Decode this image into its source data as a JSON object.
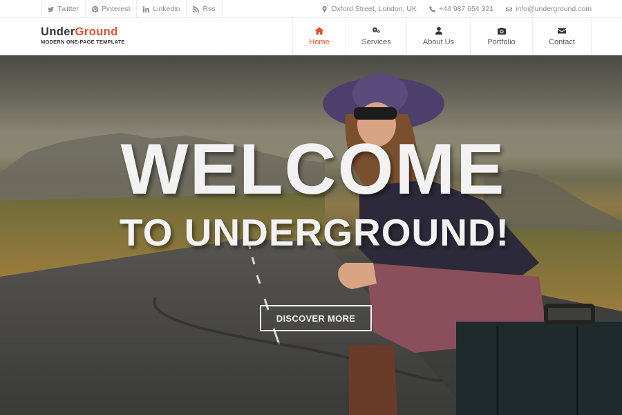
{
  "topbar": {
    "social": [
      {
        "label": "Twitter",
        "icon": "twitter-icon"
      },
      {
        "label": "Pinterest",
        "icon": "pinterest-icon"
      },
      {
        "label": "Linkedin",
        "icon": "linkedin-icon"
      },
      {
        "label": "Rss",
        "icon": "rss-icon"
      }
    ],
    "contact": {
      "address": "Oxford Street, London, UK",
      "phone": "+44 987 654 321",
      "email": "info@underground.com"
    }
  },
  "logo": {
    "part1": "Under",
    "part2": "Ground",
    "tagline": "MODERN ONE-PAGE TEMPLATE"
  },
  "nav": {
    "items": [
      {
        "label": "Home",
        "icon": "home-icon",
        "active": true
      },
      {
        "label": "Services",
        "icon": "cogs-icon",
        "active": false
      },
      {
        "label": "About Us",
        "icon": "user-icon",
        "active": false
      },
      {
        "label": "Portfolio",
        "icon": "camera-icon",
        "active": false
      },
      {
        "label": "Contact",
        "icon": "envelope-icon",
        "active": false
      }
    ]
  },
  "hero": {
    "line1": "WELCOME",
    "line2": "TO UNDERGROUND!",
    "cta_label": "DISCOVER MORE"
  },
  "colors": {
    "accent": "#e0502b",
    "text": "#333333",
    "muted": "#8a8a8a"
  }
}
